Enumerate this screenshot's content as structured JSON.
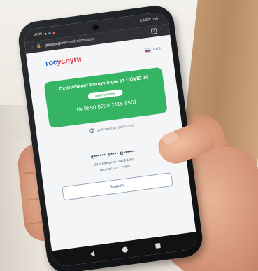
{
  "status_bar": {
    "time": "18:00",
    "right": "5.4 Б/С 100"
  },
  "browser": {
    "url_host": "gosuslugi.ru",
    "url_path": "/covid-cert/status",
    "tabs_count": "2"
  },
  "app": {
    "logo_part1": "гос",
    "logo_part2": "услуги",
    "language": "RUS"
  },
  "certificate": {
    "title": "Сертификат вакцинации от COVID-19",
    "status_badge": "Действителен",
    "number": "№ 9550 0000 2115 8561"
  },
  "validity": {
    "text": "Действует до: 13.07.2022"
  },
  "person": {
    "name": "К****** А**** С******",
    "birth": "Дата рождения: 14.08.1991",
    "passport": "Паспорт: 72 ** ***063"
  },
  "actions": {
    "close_label": "Закрыть"
  },
  "colors": {
    "card_green": "#35b563",
    "logo_blue": "#1b63c7",
    "logo_red": "#e23b4a"
  }
}
